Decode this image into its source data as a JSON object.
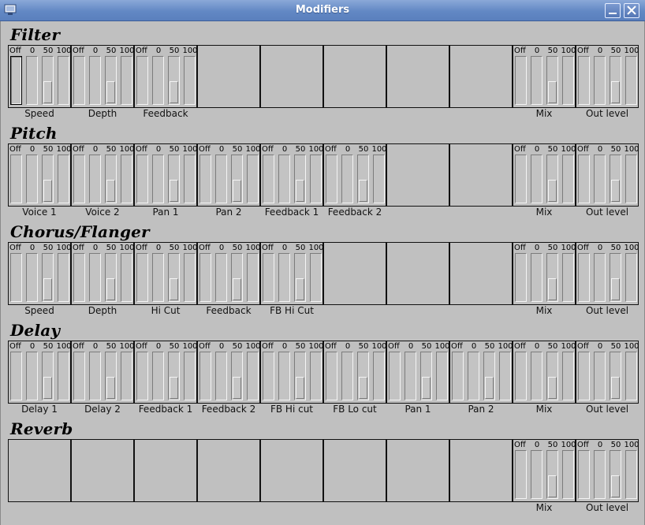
{
  "window": {
    "title": "Modifiers"
  },
  "fader_captions": [
    "Off",
    "0",
    "50",
    "100"
  ],
  "sections": [
    {
      "title": "Filter",
      "slots": [
        "Speed",
        "Depth",
        "Feedback",
        "",
        "",
        "",
        "",
        "",
        "Mix",
        "Out level"
      ]
    },
    {
      "title": "Pitch",
      "slots": [
        "Voice 1",
        "Voice 2",
        "Pan 1",
        "Pan 2",
        "Feedback 1",
        "Feedback 2",
        "",
        "",
        "Mix",
        "Out level"
      ]
    },
    {
      "title": "Chorus/Flanger",
      "slots": [
        "Speed",
        "Depth",
        "Hi Cut",
        "Feedback",
        "FB Hi Cut",
        "",
        "",
        "",
        "Mix",
        "Out level"
      ]
    },
    {
      "title": "Delay",
      "slots": [
        "Delay 1",
        "Delay 2",
        "Feedback 1",
        "Feedback 2",
        "FB Hi cut",
        "FB Lo cut",
        "Pan 1",
        "Pan 2",
        "Mix",
        "Out level"
      ]
    },
    {
      "title": "Reverb",
      "slots": [
        "",
        "",
        "",
        "",
        "",
        "",
        "",
        "",
        "Mix",
        "Out level"
      ]
    }
  ],
  "selected_level": "50",
  "colors": {
    "titlebar": "#6288c4",
    "background": "#c0c0c0"
  }
}
